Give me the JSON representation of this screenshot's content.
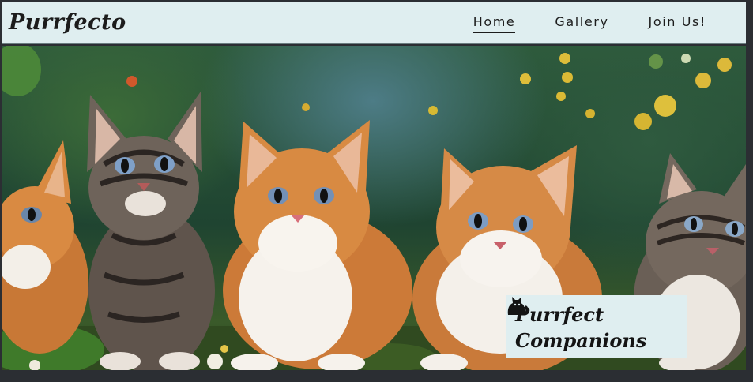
{
  "brand": {
    "name": "Purrfecto"
  },
  "nav": {
    "items": [
      {
        "label": "Home",
        "active": true
      },
      {
        "label": "Gallery",
        "active": false
      },
      {
        "label": "Join Us!",
        "active": false
      }
    ]
  },
  "hero": {
    "image": "kittens-in-garden",
    "caption_line1": "Purrfect",
    "caption_line2": "Companions",
    "caption_icon": "cat-icon"
  },
  "colors": {
    "navbar_bg": "#dfeef0",
    "text": "#1c1c1c",
    "page_bg": "#2b2e33"
  }
}
